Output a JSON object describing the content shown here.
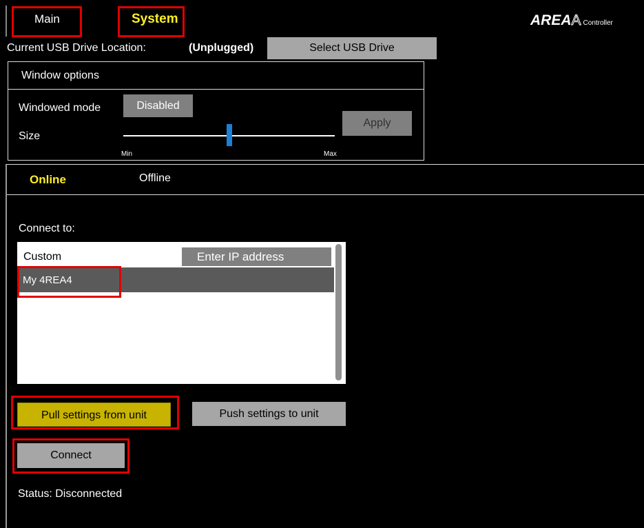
{
  "topbar": {
    "tab_main": "Main",
    "tab_system": "System",
    "logo_main": "AREA",
    "logo_glyph": "A",
    "logo_sub": "Controller"
  },
  "usb": {
    "label": "Current USB Drive Location:",
    "status": "(Unplugged)",
    "select_button": "Select USB Drive"
  },
  "window_options": {
    "title": "Window options",
    "windowed_mode_label": "Windowed mode",
    "windowed_mode_value": "Disabled",
    "size_label": "Size",
    "size_min": "Min",
    "size_max": "Max",
    "size_level": 0.5,
    "apply_button": "Apply"
  },
  "connection": {
    "tab_online": "Online",
    "tab_offline": "Offline",
    "active_tab": "Online",
    "connect_to_label": "Connect to:",
    "custom_label": "Custom",
    "ip_placeholder": "Enter IP address",
    "devices": [
      "My 4REA4"
    ],
    "pull_button": "Pull settings from unit",
    "push_button": "Push settings to unit",
    "connect_button": "Connect",
    "status": "Status: Disconnected"
  },
  "colors": {
    "accent_yellow": "#ffee22",
    "pull_button_bg": "#c8b400",
    "slider_thumb": "#1e7fd8",
    "highlight_red": "#e00000"
  }
}
